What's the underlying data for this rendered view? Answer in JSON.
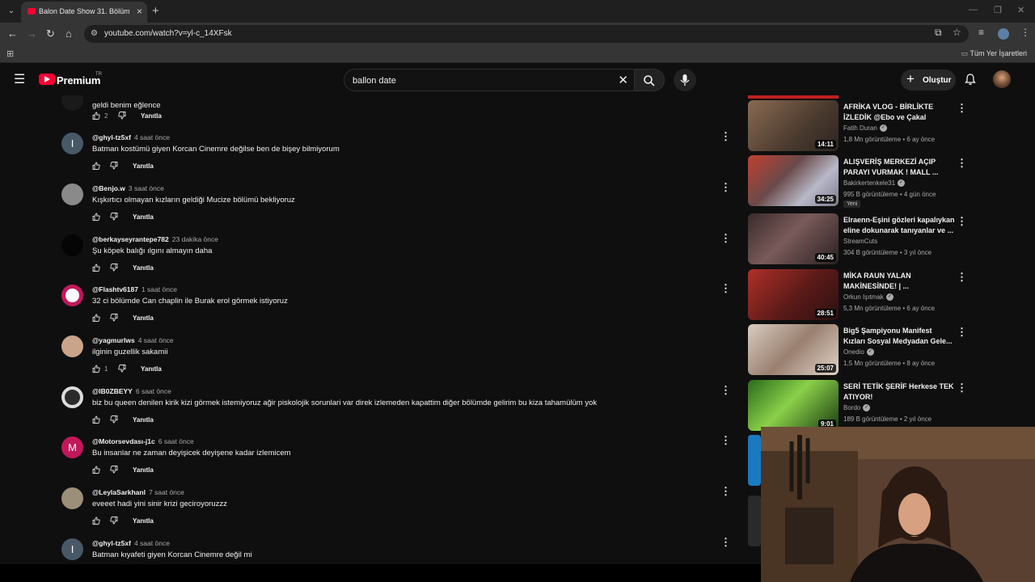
{
  "browser": {
    "tab_title": "Balon Date Show 31. Bölüm - Y",
    "url": "youtube.com/watch?v=yl-c_14XFsk",
    "bookmarks_all": "Tüm Yer İşaretleri"
  },
  "header": {
    "logo_text": "Premium",
    "logo_region": "TR",
    "search_query": "ballon date",
    "create_label": "Oluştur"
  },
  "comments": [
    {
      "author": "",
      "time": "",
      "text": "geldi benim eğlence",
      "likes": "2",
      "reply": "Yanıtla",
      "avatar_letter": "",
      "avatar_color": "#1a1a1a"
    },
    {
      "author": "@ghyl-tz5xf",
      "time": "4 saat önce",
      "text": "Batman kostümü giyen Korcan Cinemre değilse ben de bişey bilmiyorum",
      "likes": "",
      "reply": "Yanıtla",
      "avatar_letter": "I",
      "avatar_color": "#485866"
    },
    {
      "author": "@Benjo.w",
      "time": "3 saat önce",
      "text": "Kışkırtıcı olmayan kızların geldiği Mucize bölümü bekliyoruz",
      "likes": "",
      "reply": "Yanıtla",
      "avatar_letter": "",
      "avatar_color": "#8a8a8a"
    },
    {
      "author": "@berkayseyrantepe782",
      "time": "23 dakika önce",
      "text": "Şu köpek balığı ılgını almayın daha",
      "likes": "",
      "reply": "Yanıtla",
      "avatar_letter": "",
      "avatar_color": "#050505"
    },
    {
      "author": "@Flashtv6187",
      "time": "1 saat önce",
      "text": "32 ci bölümde Can chaplin ile Burak erol görmek istiyoruz",
      "likes": "",
      "reply": "Yanıtla",
      "avatar_letter": "",
      "avatar_color": "#ffffff"
    },
    {
      "author": "@yagmurlws",
      "time": "4 saat önce",
      "text": "ilginin guzellik sakamii",
      "likes": "1",
      "reply": "Yanıtla",
      "avatar_letter": "",
      "avatar_color": "#c9a48a"
    },
    {
      "author": "@IB0ZBEYY",
      "time": "6 saat önce",
      "text": "biz bu queen denilen kirik kizi görmek istemiyoruz ağir piskolojik sorunlari var direk izlemeden kapattim diğer bölümde gelirim bu kiza tahamülüm yok",
      "likes": "",
      "reply": "Yanıtla",
      "avatar_letter": "",
      "avatar_color": "#2b2b2b"
    },
    {
      "author": "@Motorsevdası-j1c",
      "time": "6 saat önce",
      "text": "Bu insanlar ne zaman deyişicek deyişene kadar izlemicem",
      "likes": "",
      "reply": "Yanıtla",
      "avatar_letter": "M",
      "avatar_color": "#c2185b"
    },
    {
      "author": "@LeylaSarkhanl",
      "time": "7 saat önce",
      "text": "eveeet hadi yini sinir krizi geciroyoruzzz",
      "likes": "",
      "reply": "Yanıtla",
      "avatar_letter": "",
      "avatar_color": "#9c8f7a"
    },
    {
      "author": "@ghyl-tz5xf",
      "time": "4 saat önce",
      "text": "Batman kıyafeti giyen Korcan Cinemre değil mi",
      "likes": "",
      "reply": "Yanıtla",
      "avatar_letter": "I",
      "avatar_color": "#485866"
    }
  ],
  "recommendations": [
    {
      "title": "AFRİKA VLOG - BİRLİKTE İZLEDİK @Ebo ve Çakal @caka...",
      "channel": "Fatih Duran",
      "verified": true,
      "views": "1,8 Mn görüntüleme",
      "age": "6 ay önce",
      "duration": "14:11",
      "badge": "",
      "thumb_color": "#7a5c46"
    },
    {
      "title": "ALIŞVERİŞ MERKEZİ AÇIP PARAYI VURMAK ! MALL ...",
      "channel": "Bakirkertenkele31",
      "verified": true,
      "views": "995 B görüntüleme",
      "age": "4 gün önce",
      "duration": "34:25",
      "badge": "Yeni",
      "thumb_color": "#8a5a4a"
    },
    {
      "title": "Elraenn-Eşini gözleri kapalıykan eline dokunarak tanıyanlar ve ...",
      "channel": "StreamCuts",
      "verified": false,
      "views": "304 B görüntüleme",
      "age": "3 yıl önce",
      "duration": "40:45",
      "badge": "",
      "thumb_color": "#5a3a3a"
    },
    {
      "title": "MİKA RAUN YALAN MAKİNESİNDE! | ...",
      "channel": "Orkun Işıtmak",
      "verified": true,
      "views": "5,3 Mn görüntüleme",
      "age": "6 ay önce",
      "duration": "28:51",
      "badge": "",
      "thumb_color": "#a0302a"
    },
    {
      "title": "Big5 Şampiyonu Manifest Kızları Sosyal Medyadan Gele...",
      "channel": "Onedio",
      "verified": true,
      "views": "1,5 Mn görüntüleme",
      "age": "8 ay önce",
      "duration": "25:07",
      "badge": "",
      "thumb_color": "#c8b8a8"
    },
    {
      "title": "SERİ TETİK ŞERİF Herkese TEK ATIYOR!",
      "channel": "Bordo",
      "verified": true,
      "views": "189 B görüntüleme",
      "age": "2 yıl önce",
      "duration": "9:01",
      "badge": "",
      "thumb_color": "#3a7a2a"
    }
  ]
}
